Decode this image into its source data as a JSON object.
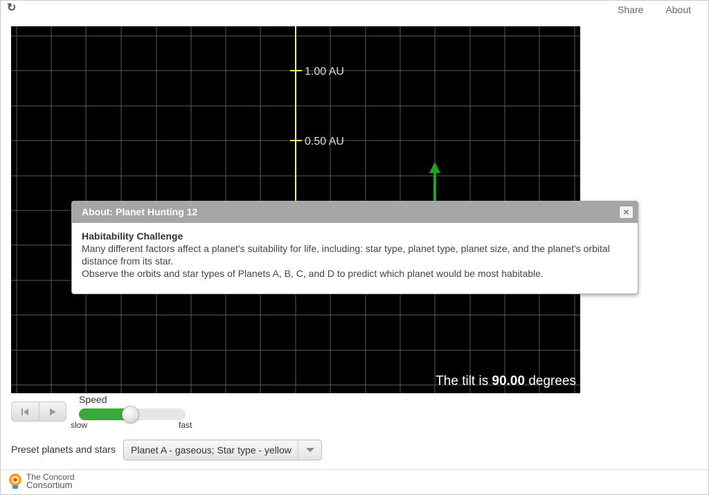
{
  "nav": {
    "share": "Share",
    "about": "About"
  },
  "sim": {
    "axis_labels": [
      "1.00 AU",
      "0.50 AU"
    ],
    "tilt_prefix": "The tilt is ",
    "tilt_value": "90.00",
    "tilt_suffix": " degrees",
    "colors": {
      "background": "#000000",
      "grid": "#5a5a5a",
      "axis": "#f5f56a",
      "star": "#c8c21a",
      "arrow": "#1aa51a"
    }
  },
  "dialog": {
    "title": "About: Planet Hunting 12",
    "close": "×",
    "heading": "Habitability Challenge",
    "line1": "Many different factors affect a planet's suitability for life, including: star type, planet type, planet size, and the planet's orbital distance from its star.",
    "line2": "Observe the orbits and star types of Planets A, B, C, and D to predict which planet would be most habitable."
  },
  "controls": {
    "speed_label": "Speed",
    "slow": "slow",
    "fast": "fast",
    "speed_level": 0.49
  },
  "preset": {
    "label": "Preset planets and stars",
    "selected": "Planet A - gaseous; Star type - yellow"
  },
  "footer": {
    "logo_line1": "The Concord",
    "logo_line2": "Consortium"
  }
}
